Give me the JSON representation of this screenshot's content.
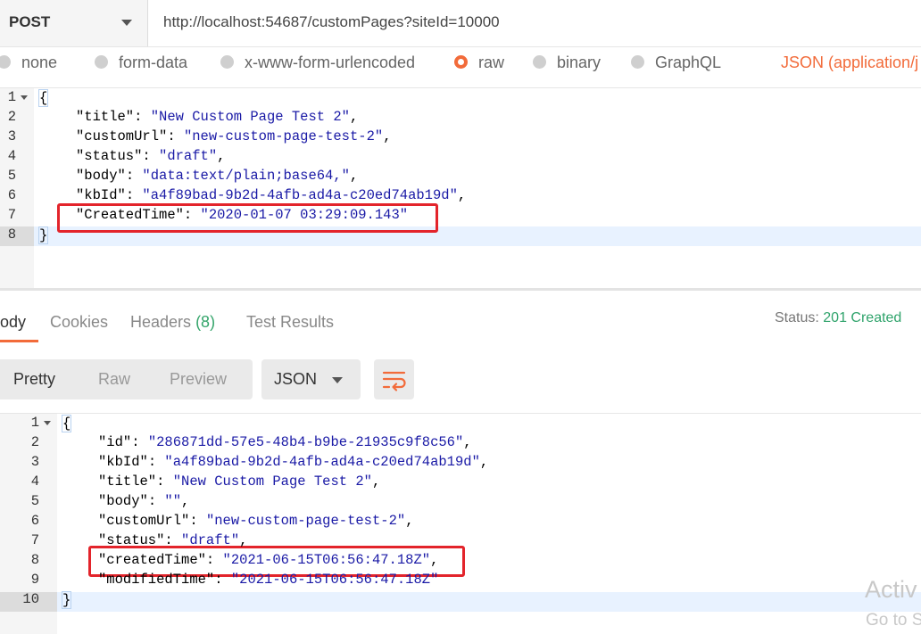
{
  "request": {
    "method": "POST",
    "url": "http://localhost:54687/customPages?siteId=10000",
    "body_types": [
      "none",
      "form-data",
      "x-www-form-urlencoded",
      "raw",
      "binary",
      "GraphQL"
    ],
    "selected_body_type": "raw",
    "content_type": "JSON (application/j"
  },
  "request_body": {
    "lines": [
      {
        "n": "1",
        "open": "{"
      },
      {
        "n": "2",
        "key": "\"title\"",
        "value": "\"New Custom Page Test 2\"",
        "trail": ","
      },
      {
        "n": "3",
        "key": "\"customUrl\"",
        "value": "\"new-custom-page-test-2\"",
        "trail": ","
      },
      {
        "n": "4",
        "key": "\"status\"",
        "value": "\"draft\"",
        "trail": ","
      },
      {
        "n": "5",
        "key": "\"body\"",
        "value": "\"data:text/plain;base64,\"",
        "trail": ","
      },
      {
        "n": "6",
        "key": "\"kbId\"",
        "value": "\"a4f89bad-9b2d-4afb-ad4a-c20ed74ab19d\"",
        "trail": ","
      },
      {
        "n": "7",
        "key": "\"CreatedTime\"",
        "value": "\"2020-01-07 03:29:09.143\"",
        "trail": ""
      },
      {
        "n": "8",
        "close": "}"
      }
    ]
  },
  "response": {
    "tabs": [
      {
        "label": "Body",
        "visible": "ody"
      },
      {
        "label": "Cookies"
      },
      {
        "label": "Headers",
        "count": "(8)"
      },
      {
        "label": "Test Results"
      }
    ],
    "status_label": "Status:",
    "status_value": "201 Created",
    "views": [
      "Pretty",
      "Raw",
      "Preview"
    ],
    "format": "JSON",
    "lines": [
      {
        "n": "1",
        "open": "{"
      },
      {
        "n": "2",
        "key": "\"id\"",
        "value": "\"286871dd-57e5-48b4-b9be-21935c9f8c56\"",
        "trail": ","
      },
      {
        "n": "3",
        "key": "\"kbId\"",
        "value": "\"a4f89bad-9b2d-4afb-ad4a-c20ed74ab19d\"",
        "trail": ","
      },
      {
        "n": "4",
        "key": "\"title\"",
        "value": "\"New Custom Page Test 2\"",
        "trail": ","
      },
      {
        "n": "5",
        "key": "\"body\"",
        "value": "\"\"",
        "trail": ","
      },
      {
        "n": "6",
        "key": "\"customUrl\"",
        "value": "\"new-custom-page-test-2\"",
        "trail": ","
      },
      {
        "n": "7",
        "key": "\"status\"",
        "value": "\"draft\"",
        "trail": ","
      },
      {
        "n": "8",
        "key": "\"createdTime\"",
        "value": "\"2021-06-15T06:56:47.18Z\"",
        "trail": ","
      },
      {
        "n": "9",
        "key": "\"modifiedTime\"",
        "value": "\"2021-06-15T06:56:47.18Z\"",
        "trail": ""
      },
      {
        "n": "10",
        "close": "}"
      }
    ]
  },
  "watermark": {
    "line1": "Activ",
    "line2": "Go to S"
  },
  "colors": {
    "accent": "#f26b3a",
    "status_ok": "#2fa36b",
    "highlight_box": "#e3242b",
    "string": "#1a1aa6"
  }
}
